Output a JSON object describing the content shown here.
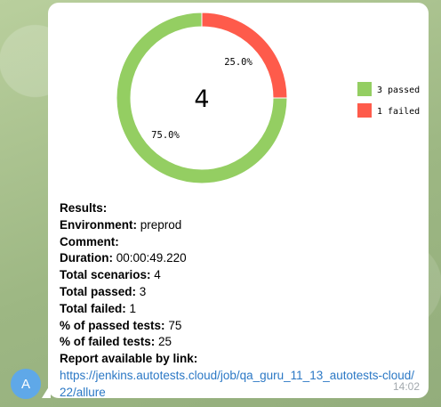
{
  "chat": {
    "avatar_letter": "A",
    "message_time": "14:02"
  },
  "chart_data": {
    "type": "pie",
    "style": "donut",
    "center_label": "4",
    "slices": [
      {
        "label": "3 passed",
        "value": 3,
        "percent_label": "75.0%",
        "color": "#94ce62"
      },
      {
        "label": "1 failed",
        "value": 1,
        "percent_label": "25.0%",
        "color": "#fe5b4b"
      }
    ],
    "legend_position": "right"
  },
  "report": {
    "results_label": "Results:",
    "environment_label": "Environment:",
    "environment_value": "preprod",
    "comment_label": "Comment:",
    "duration_label": "Duration:",
    "duration_value": "00:00:49.220",
    "total_scenarios_label": "Total scenarios:",
    "total_scenarios_value": "4",
    "total_passed_label": "Total passed:",
    "total_passed_value": "3",
    "total_failed_label": "Total failed:",
    "total_failed_value": "1",
    "passed_percent_label": "% of passed tests:",
    "passed_percent_value": "75",
    "failed_percent_label": "% of failed tests:",
    "failed_percent_value": "25",
    "link_label": "Report available by link:",
    "link_url": "https://jenkins.autotests.cloud/job/qa_guru_11_13_autotests-cloud/22/allure"
  }
}
